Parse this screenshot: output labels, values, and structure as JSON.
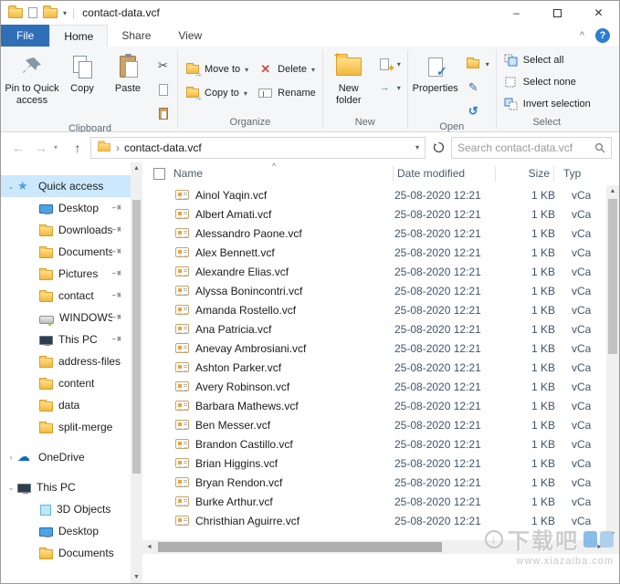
{
  "window": {
    "title": "contact-data.vcf",
    "min": "–",
    "close": "✕"
  },
  "tabs": {
    "file": "File",
    "items": [
      {
        "label": "Home"
      },
      {
        "label": "Share"
      },
      {
        "label": "View"
      }
    ]
  },
  "glyphs": {
    "dropdown": "▾",
    "cut": "✂",
    "edit": "✎",
    "history": "↺",
    "check": "✓",
    "back": "←",
    "forward": "→",
    "up": "↑",
    "breadcrumb_sep": "›",
    "collapse_ribbon": "^",
    "help": "?",
    "sort": "^",
    "delete_x": "✕",
    "move_arrow": "→",
    "copy_arrow": "→",
    "new_star": "✦",
    "easy_access_arrow": "→",
    "scroll_up": "▲",
    "scroll_down": "▼",
    "scroll_left": "◄",
    "scroll_right": "►"
  },
  "ribbon": {
    "pin_to_quick_access": "Pin to Quick access",
    "copy": "Copy",
    "paste": "Paste",
    "move_to": "Move to",
    "copy_to": "Copy to",
    "delete": "Delete",
    "rename": "Rename",
    "new_folder": "New folder",
    "properties": "Properties",
    "select_all": "Select all",
    "select_none": "Select none",
    "invert_selection": "Invert selection",
    "group_labels": [
      "Clipboard",
      "Organize",
      "New",
      "Open",
      "Select"
    ]
  },
  "addressbar": {
    "breadcrumb": "contact-data.vcf",
    "search_placeholder": "Search contact-data.vcf"
  },
  "sidebar": {
    "items": [
      {
        "label": "Quick access",
        "icon": "star",
        "level": 0,
        "arrow": "⌄",
        "selected": true
      },
      {
        "label": "Desktop",
        "icon": "desktop",
        "level": 1,
        "pinned": true
      },
      {
        "label": "Downloads",
        "icon": "folder",
        "level": 1,
        "pinned": true
      },
      {
        "label": "Documents",
        "icon": "folder",
        "level": 1,
        "pinned": true
      },
      {
        "label": "Pictures",
        "icon": "folder",
        "level": 1,
        "pinned": true
      },
      {
        "label": "contact",
        "icon": "folder",
        "level": 1,
        "pinned": true
      },
      {
        "label": "WINDOWS (C:",
        "icon": "drive",
        "level": 1,
        "pinned": true
      },
      {
        "label": "This PC",
        "icon": "pc",
        "level": 1,
        "pinned": true
      },
      {
        "label": "address-files",
        "icon": "folder",
        "level": 1
      },
      {
        "label": "content",
        "icon": "folder",
        "level": 1
      },
      {
        "label": "data",
        "icon": "folder",
        "level": 1
      },
      {
        "label": "split-merge",
        "icon": "folder",
        "level": 1
      },
      {
        "label": "OneDrive",
        "icon": "cloud",
        "level": 0,
        "arrow": "›",
        "section": true
      },
      {
        "label": "This PC",
        "icon": "pc",
        "level": 0,
        "arrow": "⌄",
        "section": true
      },
      {
        "label": "3D Objects",
        "icon": "objects3d",
        "level": 1
      },
      {
        "label": "Desktop",
        "icon": "desktop",
        "level": 1
      },
      {
        "label": "Documents",
        "icon": "folder",
        "level": 1
      }
    ]
  },
  "filelist": {
    "columns": [
      "Name",
      "Date modified",
      "Size",
      "Typ"
    ],
    "rows": [
      {
        "name": "Ainol Yaqin.vcf",
        "date": "25-08-2020 12:21",
        "size": "1 KB",
        "type": "vCa"
      },
      {
        "name": "Albert Amati.vcf",
        "date": "25-08-2020 12:21",
        "size": "1 KB",
        "type": "vCa"
      },
      {
        "name": "Alessandro Paone.vcf",
        "date": "25-08-2020 12:21",
        "size": "1 KB",
        "type": "vCa"
      },
      {
        "name": "Alex Bennett.vcf",
        "date": "25-08-2020 12:21",
        "size": "1 KB",
        "type": "vCa"
      },
      {
        "name": "Alexandre Elias.vcf",
        "date": "25-08-2020 12:21",
        "size": "1 KB",
        "type": "vCa"
      },
      {
        "name": "Alyssa Bonincontri.vcf",
        "date": "25-08-2020 12:21",
        "size": "1 KB",
        "type": "vCa"
      },
      {
        "name": "Amanda Rostello.vcf",
        "date": "25-08-2020 12:21",
        "size": "1 KB",
        "type": "vCa"
      },
      {
        "name": "Ana Patricia.vcf",
        "date": "25-08-2020 12:21",
        "size": "1 KB",
        "type": "vCa"
      },
      {
        "name": "Anevay Ambrosiani.vcf",
        "date": "25-08-2020 12:21",
        "size": "1 KB",
        "type": "vCa"
      },
      {
        "name": "Ashton Parker.vcf",
        "date": "25-08-2020 12:21",
        "size": "1 KB",
        "type": "vCa"
      },
      {
        "name": "Avery Robinson.vcf",
        "date": "25-08-2020 12:21",
        "size": "1 KB",
        "type": "vCa"
      },
      {
        "name": "Barbara Mathews.vcf",
        "date": "25-08-2020 12:21",
        "size": "1 KB",
        "type": "vCa"
      },
      {
        "name": "Ben Messer.vcf",
        "date": "25-08-2020 12:21",
        "size": "1 KB",
        "type": "vCa"
      },
      {
        "name": "Brandon Castillo.vcf",
        "date": "25-08-2020 12:21",
        "size": "1 KB",
        "type": "vCa"
      },
      {
        "name": "Brian Higgins.vcf",
        "date": "25-08-2020 12:21",
        "size": "1 KB",
        "type": "vCa"
      },
      {
        "name": "Bryan Rendon.vcf",
        "date": "25-08-2020 12:21",
        "size": "1 KB",
        "type": "vCa"
      },
      {
        "name": "Burke Arthur.vcf",
        "date": "25-08-2020 12:21",
        "size": "1 KB",
        "type": "vCa"
      },
      {
        "name": "Christhian Aguirre.vcf",
        "date": "25-08-2020 12:21",
        "size": "1 KB",
        "type": "vCa"
      }
    ]
  },
  "watermark": {
    "logo": "下载吧",
    "url": "www.xiazaiba.com"
  }
}
